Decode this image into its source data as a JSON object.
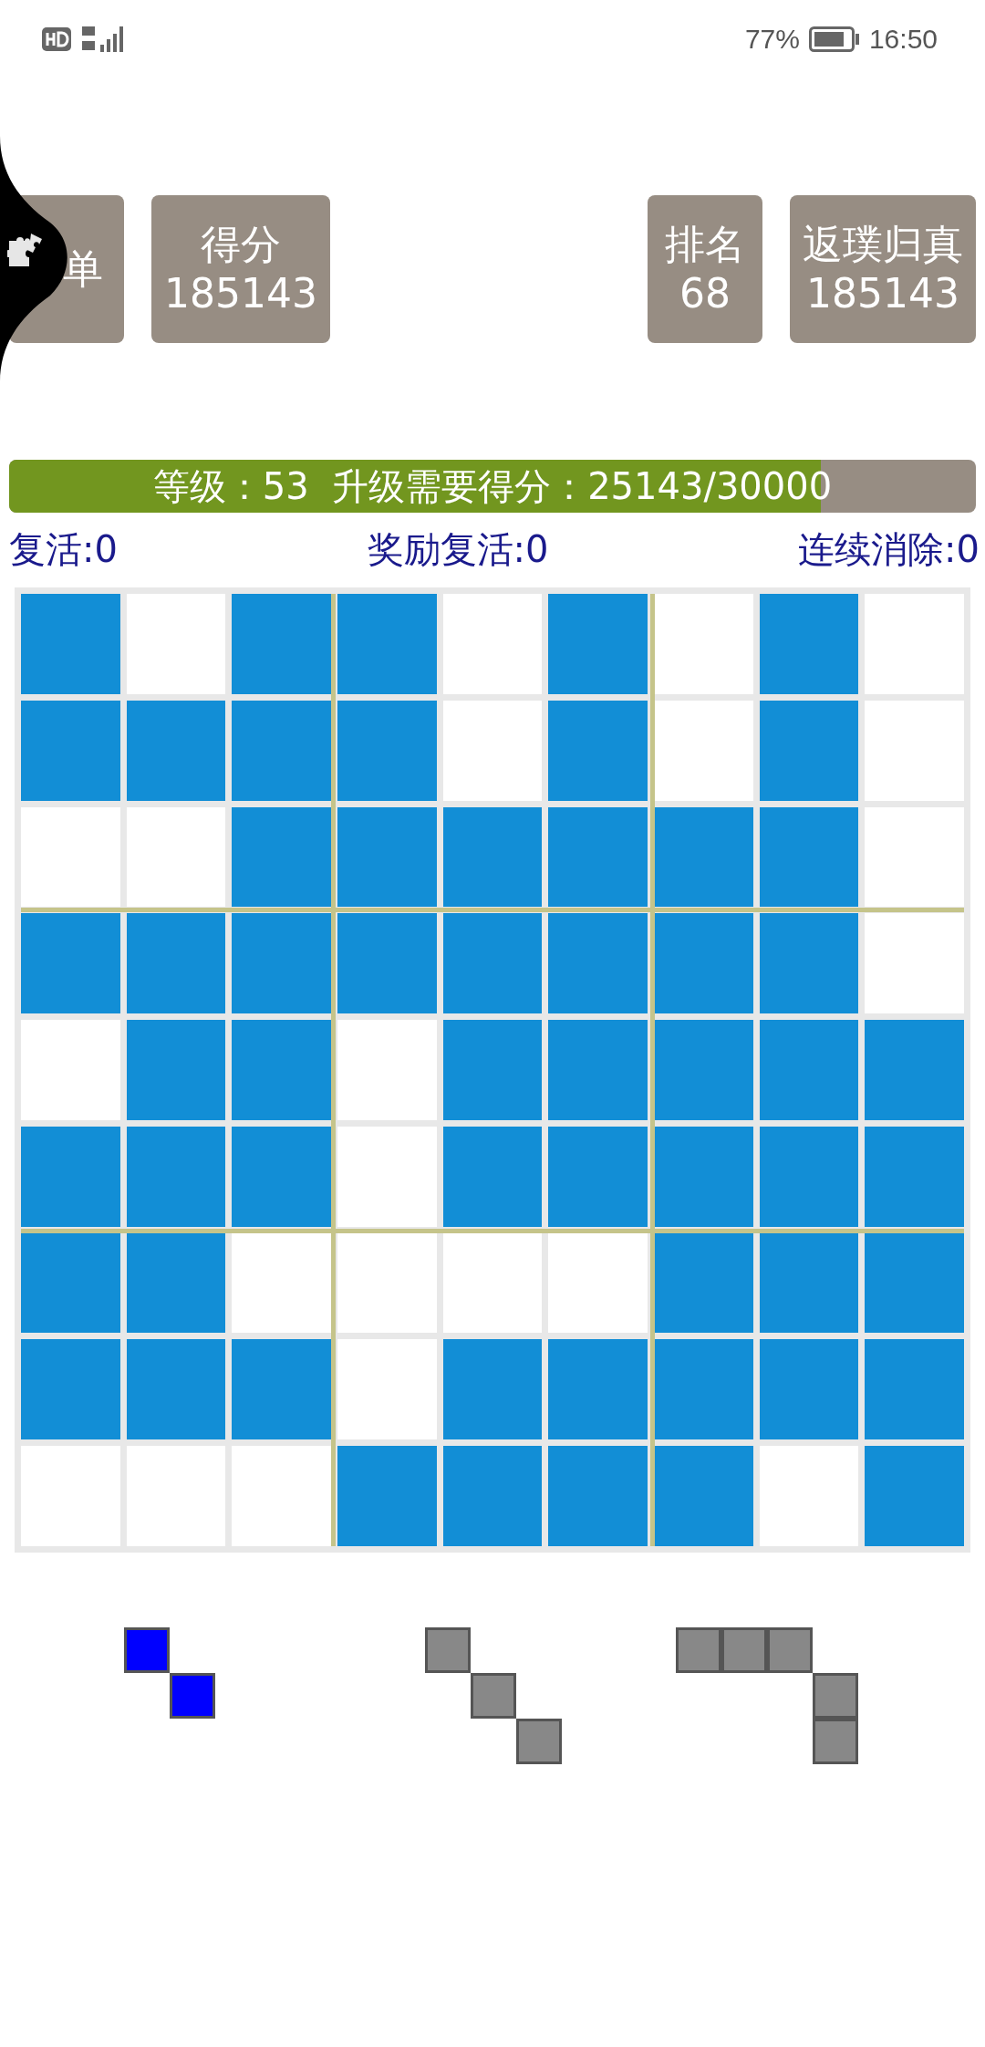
{
  "status_bar": {
    "battery": "77%",
    "time": "16:50"
  },
  "header_buttons": [
    {
      "kind": "single",
      "label": "单"
    },
    {
      "kind": "double",
      "label": "得分",
      "value": "185143"
    },
    {
      "kind": "double",
      "label": "排名",
      "value": "68"
    },
    {
      "kind": "double",
      "label": "返璞归真",
      "value": "185143"
    }
  ],
  "progress": {
    "text": "等级：53  升级需要得分：25143/30000",
    "level": 0.84
  },
  "stats": [
    "复活:0",
    "奖励复活:0",
    "连续消除:0"
  ],
  "board": {
    "rows": [
      [
        true,
        false,
        true,
        true,
        false,
        true,
        false,
        true,
        false
      ],
      [
        true,
        true,
        true,
        true,
        false,
        true,
        false,
        true,
        false
      ],
      [
        false,
        false,
        true,
        true,
        true,
        true,
        true,
        true,
        false
      ],
      [
        true,
        true,
        true,
        true,
        true,
        true,
        true,
        true,
        false
      ],
      [
        false,
        true,
        true,
        false,
        true,
        true,
        true,
        true,
        true
      ],
      [
        true,
        true,
        true,
        false,
        true,
        true,
        true,
        true,
        true
      ],
      [
        true,
        true,
        false,
        false,
        false,
        false,
        true,
        true,
        true
      ],
      [
        true,
        true,
        true,
        false,
        true,
        true,
        true,
        true,
        true
      ],
      [
        false,
        false,
        false,
        true,
        true,
        true,
        true,
        false,
        true
      ]
    ]
  },
  "pieces": [
    {
      "color": "#0000ff",
      "shape": [
        [
          true,
          false
        ],
        [
          false,
          true
        ]
      ]
    },
    {
      "color": "#888888",
      "shape": [
        [
          true,
          false,
          false
        ],
        [
          false,
          true,
          false
        ],
        [
          false,
          false,
          true
        ]
      ]
    },
    {
      "color": "#888888",
      "shape": [
        [
          true,
          true,
          true,
          false
        ],
        [
          false,
          false,
          false,
          true
        ],
        [
          false,
          false,
          false,
          true
        ]
      ]
    }
  ]
}
